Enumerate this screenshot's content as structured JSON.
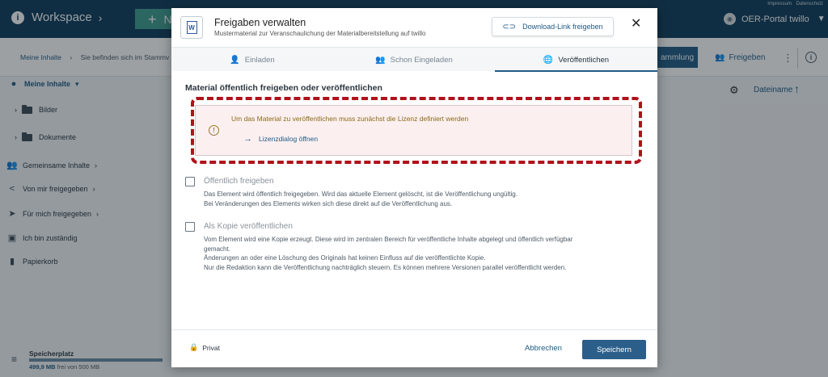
{
  "topbar": {
    "workspace_label": "Workspace",
    "new_label": "N",
    "links": [
      "Impressum",
      "Datenschutz"
    ],
    "user_label": "OER-Portal twillo"
  },
  "subbar": {
    "crumb_home": "Meine Inhalte",
    "crumb_current": "Sie befinden sich im Stammv",
    "sammlung_label": "ammlung",
    "freigeben_label": "Freigeben",
    "sort_label": "Dateiname"
  },
  "sidebar": {
    "items": [
      {
        "label": "Meine Inhalte",
        "icon": "person-icon"
      },
      {
        "label": "Bilder",
        "icon": "folder-icon"
      },
      {
        "label": "Dokumente",
        "icon": "folder-icon"
      },
      {
        "label": "Gemeinsame Inhalte",
        "icon": "group-icon"
      },
      {
        "label": "Von mir freigegeben",
        "icon": "share-icon"
      },
      {
        "label": "Für mich freigegeben",
        "icon": "send-icon"
      },
      {
        "label": "Ich bin zuständig",
        "icon": "inbox-icon"
      },
      {
        "label": "Papierkorb",
        "icon": "trash-icon"
      }
    ],
    "storage": {
      "title": "Speicherplatz",
      "used": "499,9 MB",
      "rest": "frei von 500 MB",
      "fill_fraction": 0.9998
    }
  },
  "modal": {
    "title": "Freigaben verwalten",
    "subtitle": "Mustermaterial zur Veranschaulichung der Materialbereitstellung auf twillo",
    "download_link_label": "Download-Link freigeben",
    "tabs": [
      {
        "label": "Einladen",
        "icon": "person-add-icon"
      },
      {
        "label": "Schon Eingeladen",
        "icon": "group-icon"
      },
      {
        "label": "Veröffentlichen",
        "icon": "globe-icon",
        "active": true
      }
    ],
    "section_title": "Material öffentlich freigeben oder veröffentlichen",
    "warning": {
      "text": "Um das Material zu veröffentlichen muss zunächst die Lizenz definiert werden",
      "link": "Lizenzdialog öffnen"
    },
    "options": [
      {
        "label": "Öffentlich freigeben",
        "checked": false,
        "description": [
          "Das Element wird öffentlich freigegeben. Wird das aktuelle Element gelöscht, ist die Veröffentlichung ungültig.",
          "Bei Veränderungen des Elements wirken sich diese direkt auf die Veröffentlichung aus."
        ]
      },
      {
        "label": "Als Kopie veröffentlichen",
        "checked": false,
        "description": [
          "Vom Element wird eine Kopie erzeugt. Diese wird im zentralen Bereich für veröffentliche Inhalte abgelegt und öffentlich verfügbar",
          "gemacht.",
          "Änderungen an oder eine Löschung des Originals hat keinen Einfluss auf die veröffentlichte Kopie.",
          "Nur die Redaktion kann die Veröffentlichung nachträglich steuern. Es können mehrere Versionen parallel veröffentlicht werden."
        ]
      }
    ],
    "footer": {
      "privacy_label": "Privat",
      "cancel_label": "Abbrechen",
      "save_label": "Speichern"
    }
  },
  "colors": {
    "brand_dark": "#0e3c5a",
    "accent": "#1f5a86",
    "new_button": "#3f9c8d",
    "warning_bg": "#fbeff0",
    "highlight": "#b0111a"
  }
}
